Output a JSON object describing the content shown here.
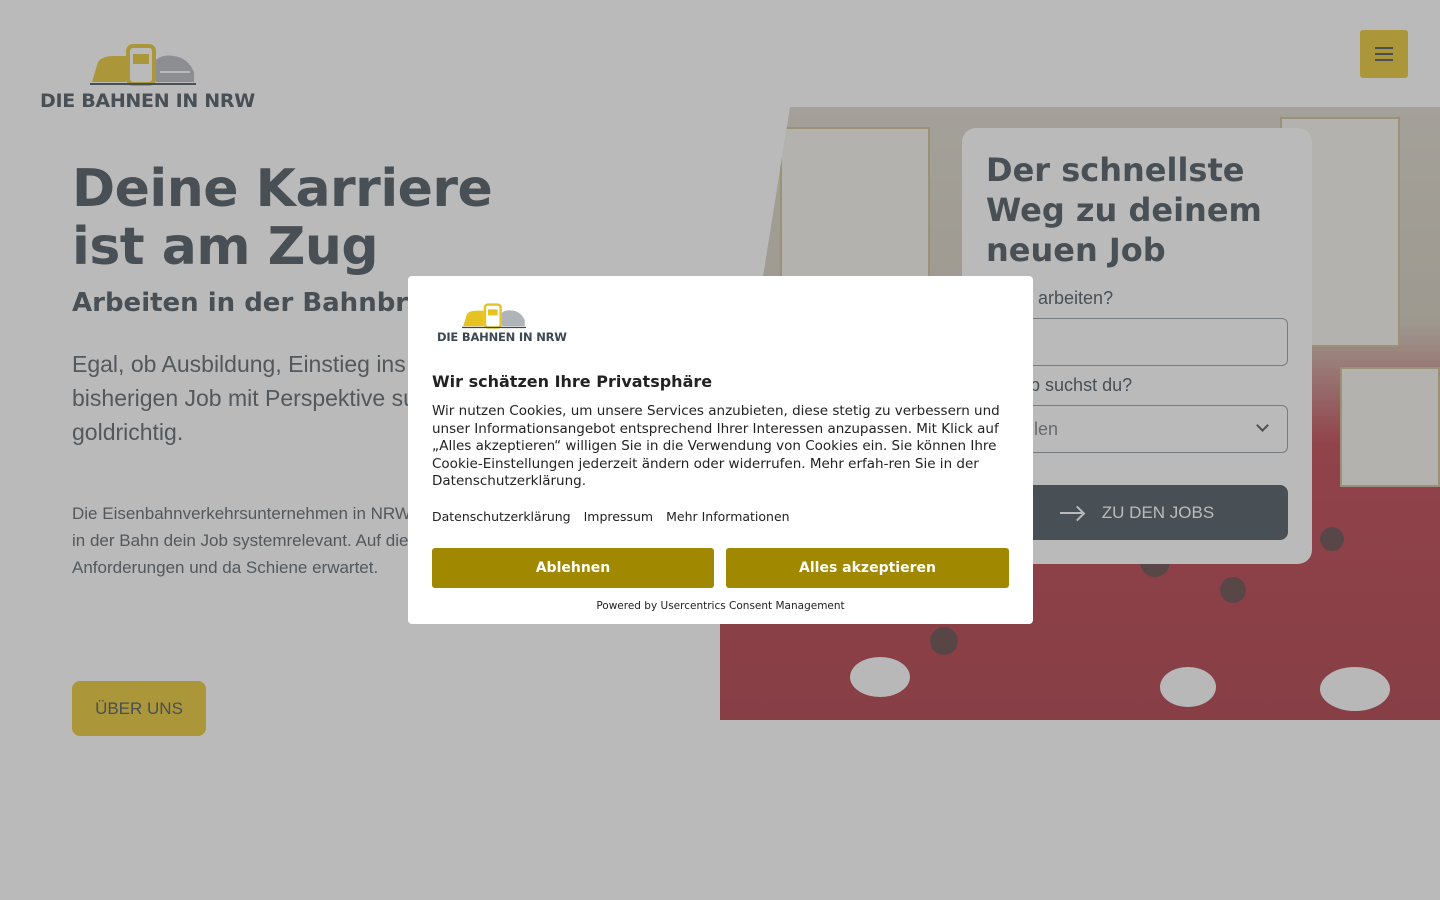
{
  "header": {
    "logo_text": "DIE BAHNEN IN NRW",
    "menu_icon": "hamburger-icon"
  },
  "hero": {
    "title_line1": "Deine Karriere",
    "title_line2": "ist am Zug",
    "subtitle": "Arbeiten in der Bahnbranc",
    "lead": "Egal, ob Ausbildung, Einstieg ins stieg von deinem bisherigen Job mit Perspektive suchst, bist du b goldrichtig.",
    "body": "Die Eisenbahnverkehrsunternehmen in NRW kräfte. Darum ist deine Karriere in der Bahn dein Job systemrelevant. Auf dieser Seite e stiegsmöglichkeiten, Anforderungen und da Schiene erwartet.",
    "about_button": "ÜBER UNS"
  },
  "job_search": {
    "title": "Der schnellste Weg zu deinem neuen Job",
    "label_where": "llst du arbeiten?",
    "input_where_value": "",
    "label_what": "en Job suchst du?",
    "select_value": "wählen",
    "submit": "ZU DEN JOBS"
  },
  "consent": {
    "logo_text": "DIE BAHNEN IN NRW",
    "title": "Wir schätzen Ihre Privatsphäre",
    "body": "Wir nutzen Cookies, um unsere Services anzubieten, diese stetig zu verbessern und unser Informationsangebot entsprechend Ihrer Interessen anzupassen. Mit Klick auf „Alles akzeptieren“ willigen Sie in die Verwendung von Cookies ein. Sie können Ihre Cookie-Einstellungen jederzeit ändern oder widerrufen. Mehr erfah-ren Sie in der Datenschutzerklärung.",
    "links": [
      "Datenschutzerklärung",
      "Impressum",
      "Mehr Informationen"
    ],
    "deny": "Ablehnen",
    "accept": "Alles akzeptieren",
    "powered_by": "Powered by Usercentrics Consent Management"
  },
  "colors": {
    "brand_yellow": "#e6c223",
    "brand_dark": "#3c4852",
    "consent_button": "#a08900"
  }
}
